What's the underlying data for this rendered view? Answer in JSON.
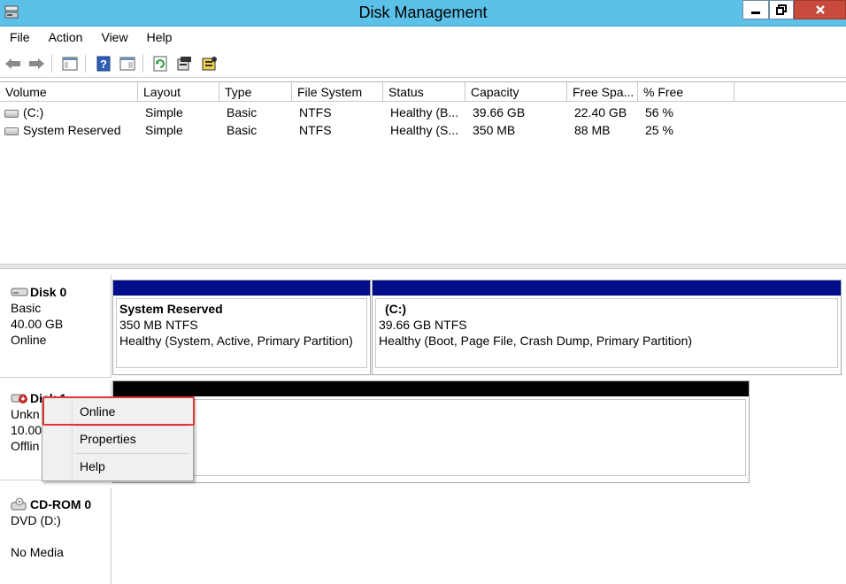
{
  "window": {
    "title": "Disk Management"
  },
  "menu": [
    "File",
    "Action",
    "View",
    "Help"
  ],
  "toolbar": {
    "icons": [
      "back-arrow-icon",
      "forward-arrow-icon",
      "console-tree-icon",
      "help-icon",
      "show-hide-icon",
      "refresh-icon",
      "properties-icon",
      "rescan-icon"
    ]
  },
  "volumes": {
    "columns": [
      "Volume",
      "Layout",
      "Type",
      "File System",
      "Status",
      "Capacity",
      "Free Spa...",
      "% Free"
    ],
    "rows": [
      {
        "volume": "(C:)",
        "layout": "Simple",
        "type": "Basic",
        "fs": "NTFS",
        "status": "Healthy (B...",
        "capacity": "39.66 GB",
        "free": "22.40 GB",
        "pct": "56 %"
      },
      {
        "volume": "System Reserved",
        "layout": "Simple",
        "type": "Basic",
        "fs": "NTFS",
        "status": "Healthy (S...",
        "capacity": "350 MB",
        "free": "88 MB",
        "pct": "25 %"
      }
    ]
  },
  "disks": {
    "disk0": {
      "name": "Disk 0",
      "type": "Basic",
      "size": "40.00 GB",
      "state": "Online",
      "partitions": [
        {
          "name": "System Reserved",
          "size": "350 MB NTFS",
          "status": "Healthy (System, Active, Primary Partition)"
        },
        {
          "name": "(C:)",
          "size": "39.66 GB NTFS",
          "status": "Healthy (Boot, Page File, Crash Dump, Primary Partition)"
        }
      ]
    },
    "disk1": {
      "name": "Disk 1",
      "type": "Unkn",
      "size": "10.00",
      "state": "Offlin"
    },
    "cdrom0": {
      "name": "CD-ROM 0",
      "type": "DVD (D:)",
      "state": "No Media"
    }
  },
  "context_menu": {
    "items": [
      "Online",
      "Properties",
      "Help"
    ]
  },
  "colors": {
    "titlebar": "#5bc1e8",
    "close": "#c74a3d",
    "primary_partition": "#000e8a",
    "unallocated": "#000000",
    "highlight": "#e0363a"
  }
}
